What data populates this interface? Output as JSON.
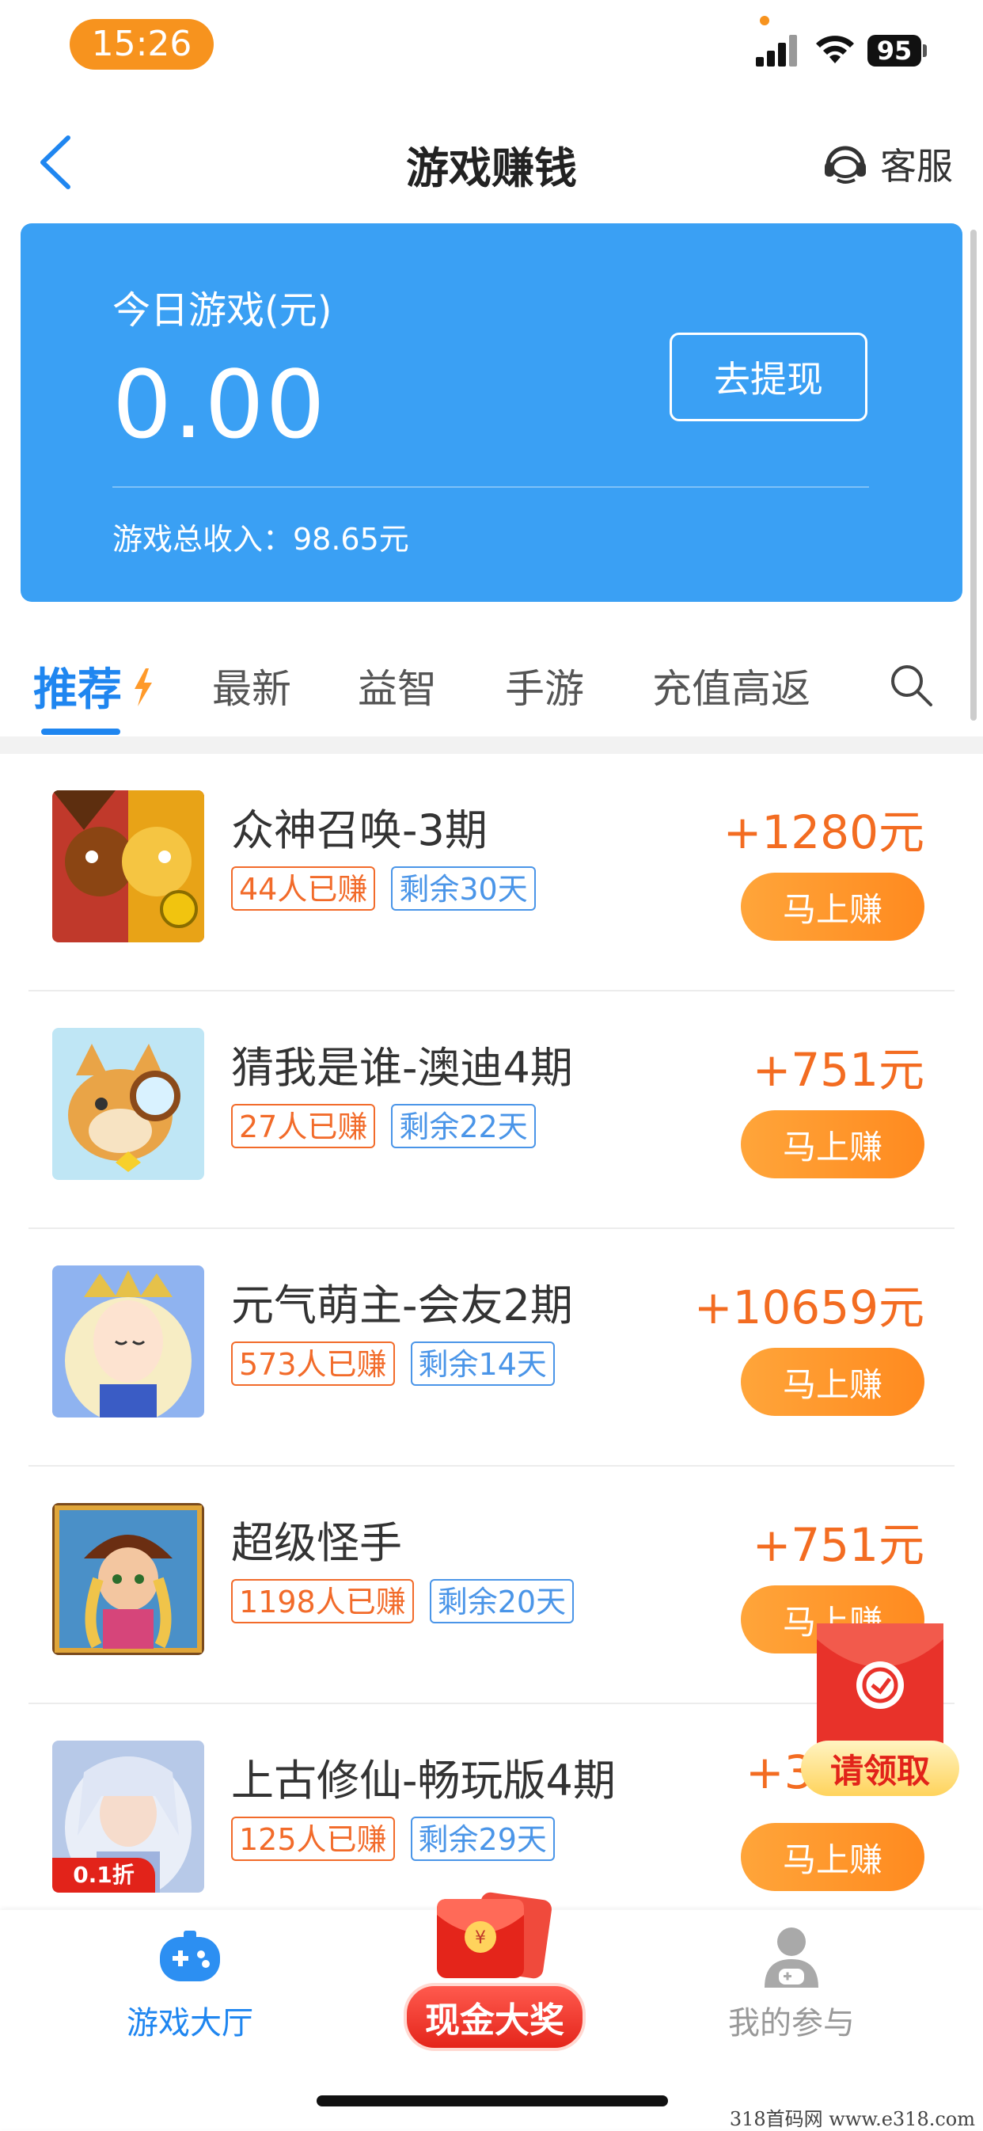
{
  "status_bar": {
    "time": "15:26",
    "battery": "95"
  },
  "nav": {
    "title": "游戏赚钱",
    "service_label": "客服"
  },
  "balance_card": {
    "label": "今日游戏(元)",
    "amount": "0.00",
    "withdraw_label": "去提现",
    "total_label": "游戏总收入：98.65元"
  },
  "tabs": [
    {
      "label": "推荐"
    },
    {
      "label": "最新"
    },
    {
      "label": "益智"
    },
    {
      "label": "手游"
    },
    {
      "label": "充值高返"
    }
  ],
  "games": [
    {
      "name": "众神召唤-3期",
      "earned": "44人已赚",
      "remaining": "剩余30天",
      "reward": "+1280元",
      "button": "马上赚"
    },
    {
      "name": "猜我是谁-澳迪4期",
      "earned": "27人已赚",
      "remaining": "剩余22天",
      "reward": "+751元",
      "button": "马上赚"
    },
    {
      "name": "元气萌主-会友2期",
      "earned": "573人已赚",
      "remaining": "剩余14天",
      "reward": "+10659元",
      "button": "马上赚"
    },
    {
      "name": "超级怪手",
      "earned": "1198人已赚",
      "remaining": "剩余20天",
      "reward": "+751元",
      "button": "马上赚"
    },
    {
      "name": "上古修仙-畅玩版4期",
      "earned": "125人已赚",
      "remaining": "剩余29天",
      "reward": "+3",
      "button": "马上赚",
      "thumb_badge": "0.1折"
    }
  ],
  "floating_packet": {
    "label": "请领取"
  },
  "bottom_nav": {
    "left": "游戏大厅",
    "center": "现金大奖",
    "right": "我的参与"
  },
  "colors": {
    "primary_blue": "#3aa0f4",
    "accent_orange": "#f36c21",
    "tab_blue": "#1f86f0"
  },
  "watermark": "318首码网  www.e318.com"
}
